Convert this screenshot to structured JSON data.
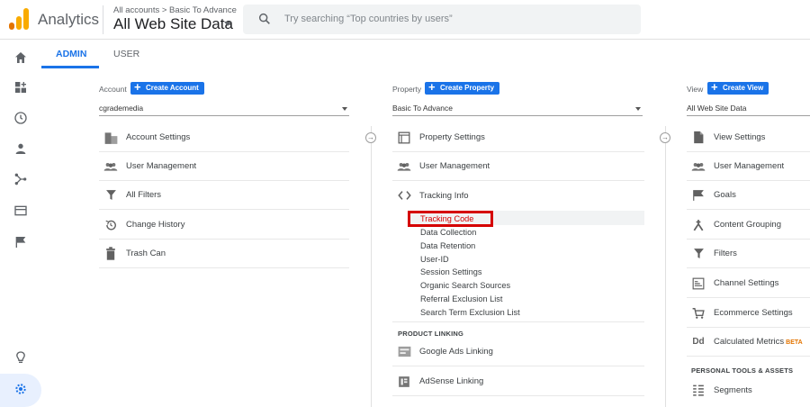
{
  "header": {
    "app_title": "Analytics",
    "breadcrumb": "All accounts > Basic To Advance",
    "account_view": "All Web Site Data",
    "search_placeholder": "Try searching “Top countries by users”"
  },
  "tabs": [
    {
      "label": "ADMIN",
      "active": true
    },
    {
      "label": "USER",
      "active": false
    }
  ],
  "sidenav": [
    "home-icon",
    "customization-icon",
    "realtime-icon",
    "audience-icon",
    "acquisition-icon",
    "behavior-icon",
    "conversions-icon",
    "discover-icon",
    "admin-gear-icon"
  ],
  "account": {
    "label": "Account",
    "create_label": "Create Account",
    "selected": "cgrademedia",
    "items": [
      "Account Settings",
      "User Management",
      "All Filters",
      "Change History",
      "Trash Can"
    ]
  },
  "property": {
    "label": "Property",
    "create_label": "Create Property",
    "selected": "Basic To Advance",
    "items": [
      "Property Settings",
      "User Management",
      "Tracking Info"
    ],
    "tracking_sub": [
      "Tracking Code",
      "Data Collection",
      "Data Retention",
      "User-ID",
      "Session Settings",
      "Organic Search Sources",
      "Referral Exclusion List",
      "Search Term Exclusion List"
    ],
    "section": "PRODUCT LINKING",
    "linking": [
      "Google Ads Linking",
      "AdSense Linking"
    ]
  },
  "view": {
    "label": "View",
    "create_label": "Create View",
    "selected": "All Web Site Data",
    "items": [
      "View Settings",
      "User Management",
      "Goals",
      "Content Grouping",
      "Filters",
      "Channel Settings",
      "Ecommerce Settings",
      "Calculated Metrics"
    ],
    "beta": "BETA",
    "section": "PERSONAL TOOLS & ASSETS",
    "tools": [
      "Segments"
    ]
  },
  "colors": {
    "accent": "#1a73e8",
    "highlight": "#d50000",
    "logo_orange": "#f9ab00",
    "logo_dark": "#e37400"
  }
}
